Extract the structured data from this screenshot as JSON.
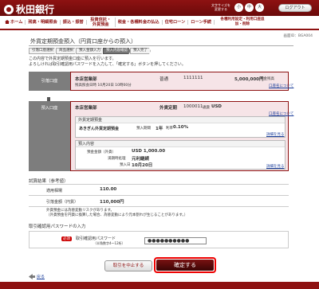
{
  "header": {
    "bank_name": "秋田銀行",
    "font_size_label": "文字サイズを変更する",
    "font_sizes": [
      "小",
      "中",
      "大"
    ],
    "logout": "ログアウト"
  },
  "nav": [
    "ホーム",
    "残高・明細照会",
    "振込・振替",
    "投資信託・外貨預金",
    "税金・各種料金の払込",
    "住宅ローン",
    "ローン手続",
    "各種利用設定・利用口座追加・削除"
  ],
  "screen_id": "画面ID：BGA004",
  "page_title": "外貨定期預金預入（円貨口座からの預入）",
  "steps": [
    "引落口座選択",
    "商品選択",
    "預入金額入力",
    "預入内容確認",
    "預入完了"
  ],
  "intro": [
    "この内容で外貨定期預金口座に預入を行います。",
    "よろしければ取引確認用パスワードを入力して、「確定する」ボタンを押してください。"
  ],
  "debit": {
    "label": "引落口座",
    "branch": "本店営業部",
    "type": "普通",
    "number": "1111111",
    "amount": "5,000,000円",
    "amount_note": "預金残高",
    "ref": "残高照会日時 10月20日 10時00分",
    "link": "口座名について"
  },
  "deposit": {
    "label": "預入口座",
    "branch": "本店営業部",
    "type": "外貨定期",
    "number": "1000011",
    "ccy_label": "通貨",
    "ccy": "USD",
    "link": "口座名について"
  },
  "product": {
    "header": "外貨定期預金",
    "name": "あきぎん外貨定期預金",
    "term_label": "預入期間",
    "term": "1年",
    "rate_label": "利率",
    "rate": "0.10%",
    "link": "詳細を見る"
  },
  "contents": {
    "header": "預入内容",
    "amount_label": "預金金額（外貨）",
    "amount": "USD 1,000.00",
    "maturity_label": "満期時処理",
    "maturity": "元利継続",
    "date_label": "預入日",
    "date": "10月20日",
    "link": "詳細を見る"
  },
  "trial": {
    "header": "試算結果（参考値）",
    "rate_label": "適用相場",
    "rate": "110.00",
    "yen_label": "引落金額（円貨）",
    "yen": "110,000円",
    "notes": [
      "外貨預金には為替変動リスクがあります。",
      "（外貨預金を円貨に換算した場合、為替変動により元本割れが生じることがあります。）"
    ]
  },
  "password": {
    "header": "取引確認用パスワードの入力",
    "required": "必須",
    "label": "取引確認用パスワード",
    "hint": "（半角数字4～12桁）",
    "value": "●●●●●●●●●●"
  },
  "buttons": {
    "cancel": "取引を中止する",
    "confirm": "確定する",
    "back": "戻る"
  }
}
